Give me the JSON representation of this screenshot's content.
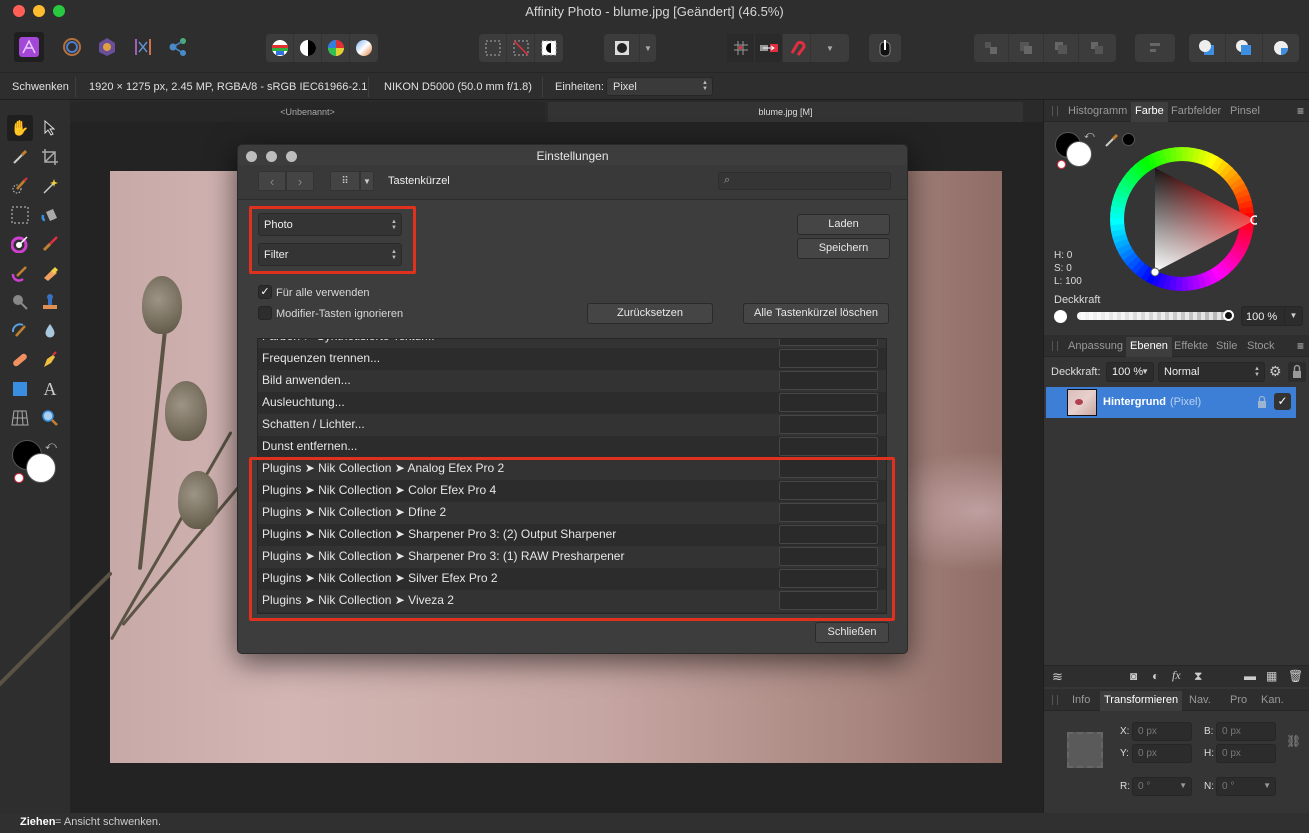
{
  "window": {
    "title": "Affinity Photo - blume.jpg [Geändert] (46.5%)",
    "traffic_lights": [
      "close",
      "minimize",
      "zoom"
    ]
  },
  "toolbar": {
    "personas": [
      "photo-persona",
      "liquify-persona",
      "develop-persona",
      "tone-mapping-persona",
      "export-persona"
    ],
    "adjust_group": [
      "auto-levels",
      "auto-contrast",
      "auto-colors",
      "auto-white-balance"
    ],
    "selection_group": [
      "select-all",
      "deselect",
      "invert-pixel-selection"
    ],
    "quickmask": "quick-mask",
    "snap_group": [
      "snapping-grid",
      "force-pixel-alignment",
      "snapping-magnet"
    ],
    "assistant": "assistant-manager",
    "arrange_group": [
      "move-to-back",
      "move-back-one",
      "move-forward-one",
      "move-to-front"
    ],
    "align": "alignment",
    "boolean_group": [
      "add",
      "subtract",
      "intersect"
    ]
  },
  "context_bar": {
    "tool_name": "Schwenken",
    "image_info": "1920 × 1275 px, 2.45 MP, RGBA/8 - sRGB IEC61966-2.1",
    "camera": "NIKON D5000 (50.0 mm f/1.8)",
    "units_label": "Einheiten:",
    "units_value": "Pixel"
  },
  "doc_tabs": [
    {
      "label": "<Unbenannt>",
      "active": false
    },
    {
      "label": "blume.jpg [M]",
      "active": true
    }
  ],
  "tools": [
    "hand-tool",
    "move-tool",
    "color-picker-tool",
    "crop-tool",
    "selection-brush-tool",
    "flood-select-tool",
    "rectangular-marquee-tool",
    "flood-fill-tool",
    "color-replacement-tool",
    "paint-brush-tool",
    "pixel-tool",
    "erase-brush-tool",
    "dodge-tool",
    "clone-brush-tool",
    "smudge-tool",
    "blur-brush-tool",
    "inpainting-tool",
    "pen-tool",
    "rectangle-tool",
    "artistic-text-tool",
    "mesh-warp-tool",
    "zoom-tool"
  ],
  "dialog": {
    "title": "Einstellungen",
    "section": "Tastenkürzel",
    "search_placeholder": "",
    "app_select": "Photo",
    "category_select": "Filter",
    "load_button": "Laden",
    "save_button": "Speichern",
    "use_for_all": {
      "label": "Für alle verwenden",
      "checked": true
    },
    "ignore_modifiers": {
      "label": "Modifier-Tasten ignorieren",
      "checked": false
    },
    "reset_button": "Zurücksetzen",
    "clear_all_button": "Alle Tastenkürzel löschen",
    "close_button": "Schließen",
    "shortcuts": [
      {
        "label": "Farben ➤ Synthetisierte Textur...",
        "key": ""
      },
      {
        "label": "Frequenzen trennen...",
        "key": ""
      },
      {
        "label": "Bild anwenden...",
        "key": ""
      },
      {
        "label": "Ausleuchtung...",
        "key": ""
      },
      {
        "label": "Schatten / Lichter...",
        "key": ""
      },
      {
        "label": "Dunst entfernen...",
        "key": ""
      },
      {
        "label": "Plugins ➤ Nik Collection ➤ Analog Efex Pro 2",
        "key": ""
      },
      {
        "label": "Plugins ➤ Nik Collection ➤ Color Efex Pro 4",
        "key": ""
      },
      {
        "label": "Plugins ➤ Nik Collection ➤ Dfine 2",
        "key": ""
      },
      {
        "label": "Plugins ➤ Nik Collection ➤ Sharpener Pro 3: (2) Output Sharpener",
        "key": ""
      },
      {
        "label": "Plugins ➤ Nik Collection ➤ Sharpener Pro 3: (1) RAW Presharpener",
        "key": ""
      },
      {
        "label": "Plugins ➤ Nik Collection ➤ Silver Efex Pro 2",
        "key": ""
      },
      {
        "label": "Plugins ➤ Nik Collection ➤ Viveza 2",
        "key": ""
      }
    ],
    "highlight_color": "#e0301e"
  },
  "color_panel": {
    "tabs": [
      "Histogramm",
      "Farbe",
      "Farbfelder",
      "Pinsel"
    ],
    "active_tab": "Farbe",
    "h_label": "H: 0",
    "s_label": "S: 0",
    "l_label": "L: 100",
    "opacity_label": "Deckkraft",
    "opacity_value": "100 %",
    "opacity_fraction": 1.0
  },
  "layers_panel": {
    "tabs": [
      "Anpassung",
      "Ebenen",
      "Effekte",
      "Stile",
      "Stock"
    ],
    "active_tab": "Ebenen",
    "opacity_label": "Deckkraft:",
    "opacity_value": "100 %",
    "blend_mode": "Normal",
    "layers": [
      {
        "name": "Hintergrund",
        "type": "(Pixel)",
        "visible": true,
        "selected": true
      }
    ],
    "selection_color": "#3d7ed6"
  },
  "transform_panel": {
    "tabs": [
      "Info",
      "Transformieren",
      "Nav.",
      "Pro",
      "Kan."
    ],
    "active_tab": "Transformieren",
    "x_label": "X:",
    "x_value": "0 px",
    "y_label": "Y:",
    "y_value": "0 px",
    "b_label": "B:",
    "b_value": "0 px",
    "h_label": "H:",
    "h_value": "0 px",
    "r_label": "R:",
    "r_value": "0 °",
    "n_label": "N:",
    "n_value": "0 °"
  },
  "status_bar": {
    "bold": "Ziehen",
    "text": " = Ansicht schwenken."
  }
}
